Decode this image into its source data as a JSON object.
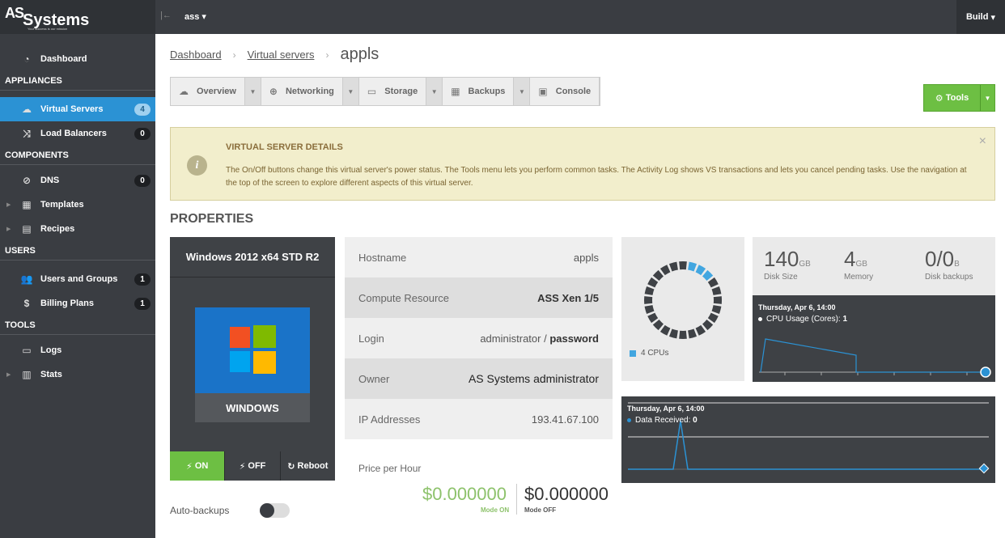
{
  "brand": {
    "logo_as": "AS",
    "logo_systems": "Systems",
    "tagline": "Your success is our mission"
  },
  "topbar": {
    "cloud": "ass",
    "build": "Build"
  },
  "sidebar": {
    "dashboard": "Dashboard",
    "sections": {
      "appliances": "APPLIANCES",
      "components": "COMPONENTS",
      "users": "USERS",
      "tools": "TOOLS"
    },
    "virtual_servers": {
      "label": "Virtual Servers",
      "count": "4"
    },
    "load_balancers": {
      "label": "Load Balancers",
      "count": "0"
    },
    "dns": {
      "label": "DNS",
      "count": "0"
    },
    "templates": "Templates",
    "recipes": "Recipes",
    "users_groups": {
      "label": "Users and Groups",
      "count": "1"
    },
    "billing_plans": {
      "label": "Billing Plans",
      "count": "1"
    },
    "logs": "Logs",
    "stats": "Stats"
  },
  "breadcrumb": {
    "dashboard": "Dashboard",
    "virtual_servers": "Virtual servers",
    "current": "appls"
  },
  "tabs": {
    "overview": "Overview",
    "networking": "Networking",
    "storage": "Storage",
    "backups": "Backups",
    "console": "Console"
  },
  "tools_button": "Tools",
  "alert": {
    "title": "VIRTUAL SERVER DETAILS",
    "text": "The On/Off buttons change this virtual server's power status. The Tools menu lets you perform common tasks. The Activity Log shows VS transactions and lets you cancel pending tasks. Use the navigation at the top of the screen to explore different aspects of this virtual server.",
    "close": "×"
  },
  "properties_title": "PROPERTIES",
  "os_card": {
    "name": "Windows 2012 x64 STD R2",
    "os": "WINDOWS",
    "on": "ON",
    "off": "OFF",
    "reboot": "Reboot"
  },
  "details": {
    "hostname": {
      "k": "Hostname",
      "v": "appls"
    },
    "compute": {
      "k": "Compute Resource",
      "v": "ASS Xen 1/5"
    },
    "login": {
      "k": "Login",
      "user": "administrator",
      "sep": " / ",
      "password": "password"
    },
    "owner": {
      "k": "Owner",
      "v": "AS Systems administrator"
    },
    "ip": {
      "k": "IP Addresses",
      "v": "193.41.67.100"
    }
  },
  "price": {
    "label": "Price per Hour",
    "on": "$0.000000",
    "on_label": "Mode ON",
    "off": "$0.000000",
    "off_label": "Mode OFF"
  },
  "auto_backups": {
    "label": "Auto-backups",
    "enabled": false
  },
  "cpu": {
    "legend": "4 CPUs",
    "segments_total": 24,
    "segments_used": 3,
    "used_color": "#42a6e0",
    "free_color": "#3f4246"
  },
  "stats": {
    "disk": {
      "value": "140",
      "unit": "GB",
      "label": "Disk Size"
    },
    "memory": {
      "value": "4",
      "unit": "GB",
      "label": "Memory"
    },
    "backups": {
      "value": "0/0",
      "unit": "B",
      "label": "Disk backups"
    }
  },
  "cpu_chart": {
    "time": "Thursday, Apr 6, 14:00",
    "series": "CPU Usage (Cores):",
    "value": "1"
  },
  "net_chart": {
    "time": "Thursday, Apr 6, 14:00",
    "series": "Data Received:",
    "value": "0"
  },
  "colors": {
    "accent": "#2b92d4",
    "on_green": "#6dbf43",
    "sidebar": "#3a3d42"
  }
}
